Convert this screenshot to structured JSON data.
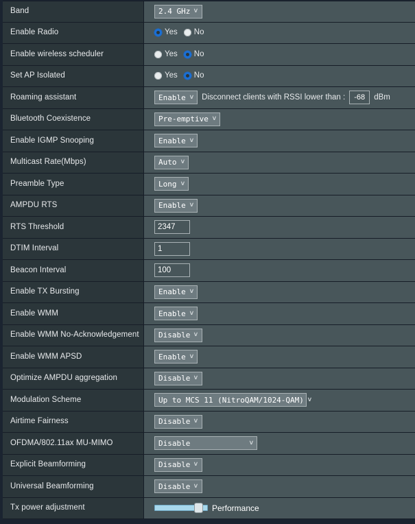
{
  "rows": [
    {
      "label": "Band",
      "control": "select",
      "value": "2.4 GHz",
      "name": "band"
    },
    {
      "label": "Enable Radio",
      "control": "radio",
      "options": [
        "Yes",
        "No"
      ],
      "selected": "Yes",
      "name": "enable-radio"
    },
    {
      "label": "Enable wireless scheduler",
      "control": "radio",
      "options": [
        "Yes",
        "No"
      ],
      "selected": "No",
      "name": "enable-wireless-scheduler"
    },
    {
      "label": "Set AP Isolated",
      "control": "radio",
      "options": [
        "Yes",
        "No"
      ],
      "selected": "No",
      "name": "set-ap-isolated"
    },
    {
      "label": "Roaming assistant",
      "control": "select-with-input",
      "value": "Enable",
      "extra_text": "Disconnect clients with RSSI lower than :",
      "input_value": "-68",
      "unit": "dBm",
      "name": "roaming-assistant"
    },
    {
      "label": "Bluetooth Coexistence",
      "control": "select",
      "value": "Pre-emptive",
      "name": "bluetooth-coexistence"
    },
    {
      "label": "Enable IGMP Snooping",
      "control": "select",
      "value": "Enable",
      "name": "enable-igmp-snooping"
    },
    {
      "label": "Multicast Rate(Mbps)",
      "control": "select",
      "value": "Auto",
      "name": "multicast-rate"
    },
    {
      "label": "Preamble Type",
      "control": "select",
      "value": "Long",
      "name": "preamble-type"
    },
    {
      "label": "AMPDU RTS",
      "control": "select",
      "value": "Enable",
      "name": "ampdu-rts"
    },
    {
      "label": "RTS Threshold",
      "control": "input",
      "value": "2347",
      "name": "rts-threshold"
    },
    {
      "label": "DTIM Interval",
      "control": "input",
      "value": "1",
      "name": "dtim-interval"
    },
    {
      "label": "Beacon Interval",
      "control": "input",
      "value": "100",
      "name": "beacon-interval"
    },
    {
      "label": "Enable TX Bursting",
      "control": "select",
      "value": "Enable",
      "name": "enable-tx-bursting"
    },
    {
      "label": "Enable WMM",
      "control": "select",
      "value": "Enable",
      "name": "enable-wmm"
    },
    {
      "label": "Enable WMM No-Acknowledgement",
      "control": "select",
      "value": "Disable",
      "name": "enable-wmm-no-acknowledgement"
    },
    {
      "label": "Enable WMM APSD",
      "control": "select",
      "value": "Enable",
      "name": "enable-wmm-apsd"
    },
    {
      "label": "Optimize AMPDU aggregation",
      "control": "select",
      "value": "Disable",
      "name": "optimize-ampdu-aggregation"
    },
    {
      "label": "Modulation Scheme",
      "control": "select",
      "value": "Up to MCS 11 (NitroQAM/1024-QAM)",
      "width": "wide2",
      "name": "modulation-scheme"
    },
    {
      "label": "Airtime Fairness",
      "control": "select",
      "value": "Disable",
      "name": "airtime-fairness"
    },
    {
      "label": "OFDMA/802.11ax MU-MIMO",
      "control": "select",
      "value": "Disable",
      "width": "wide",
      "name": "ofdma-mu-mimo"
    },
    {
      "label": "Explicit Beamforming",
      "control": "select",
      "value": "Disable",
      "name": "explicit-beamforming"
    },
    {
      "label": "Universal Beamforming",
      "control": "select",
      "value": "Disable",
      "name": "universal-beamforming"
    },
    {
      "label": "Tx power adjustment",
      "control": "slider",
      "slider_label": "Performance",
      "slider_percent": 82,
      "name": "tx-power-adjustment"
    }
  ],
  "icons": {
    "dropdown_arrow": "chevron-down-icon"
  },
  "colors": {
    "page_background": "#1b2430",
    "label_column": "#2b363a",
    "value_column": "#48565a",
    "row_border": "#161d27",
    "select_background": "#6e7b80",
    "select_border": "#a9b2b5",
    "text": "#e8eaec",
    "radio_selected": "#1b6fd4",
    "radio_unselected": "#e9edee",
    "slider_track": "#a8d8ec",
    "slider_handle": "#dfe6e9"
  }
}
